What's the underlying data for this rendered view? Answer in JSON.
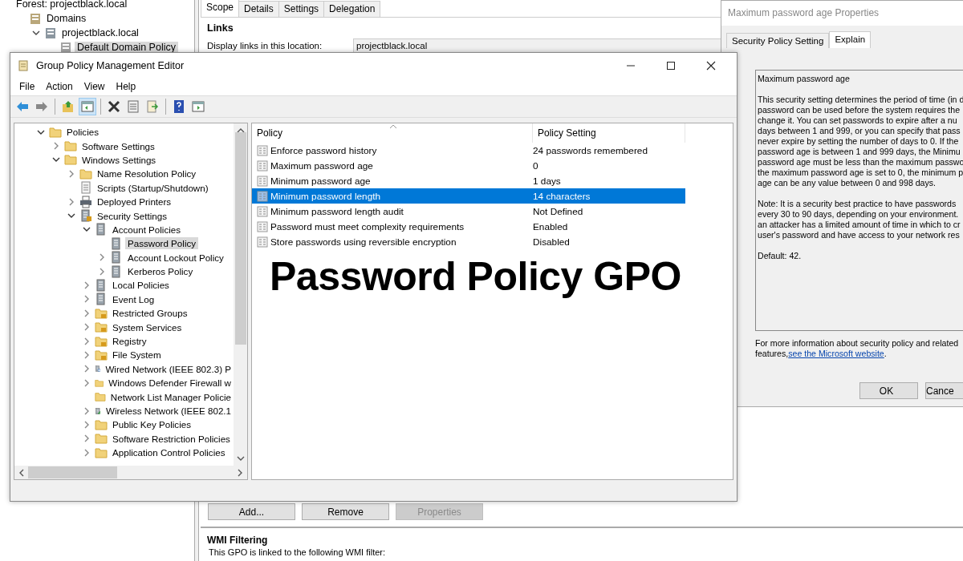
{
  "background_window": {
    "tree": [
      {
        "label": "Forest: projectblack.local",
        "selected": false,
        "children": [
          {
            "label": "Domains",
            "selected": false,
            "children": [
              {
                "label": "projectblack.local",
                "expanded": true,
                "selected": false,
                "children": [
                  {
                    "label": "Default Domain Policy",
                    "selected": true
                  }
                ]
              }
            ]
          }
        ]
      }
    ],
    "tabs": [
      {
        "label": "Scope",
        "selected": true
      },
      {
        "label": "Details",
        "selected": false
      },
      {
        "label": "Settings",
        "selected": false
      },
      {
        "label": "Delegation",
        "selected": false
      }
    ],
    "links_heading": "Links",
    "links_label": "Display links in this location:",
    "links_value": "projectblack.local",
    "buttons": [
      {
        "label": "Add...",
        "disabled": false
      },
      {
        "label": "Remove",
        "disabled": false
      },
      {
        "label": "Properties",
        "disabled": true
      }
    ],
    "wmi_heading": "WMI Filtering",
    "wmi_text": "This GPO is linked to the following WMI filter:"
  },
  "editor": {
    "title": "Group Policy Management Editor",
    "menu": [
      "File",
      "Action",
      "View",
      "Help"
    ],
    "toolbar": [
      {
        "pressed": false
      },
      {
        "pressed": false
      },
      {
        "pressed": false
      },
      {
        "pressed": true
      },
      {
        "pressed": false
      },
      {
        "pressed": false
      },
      {
        "pressed": false
      },
      {
        "pressed": false
      },
      {
        "pressed": false
      }
    ],
    "tree": [
      {
        "label": "Policies",
        "expanded": true,
        "selected": false,
        "children": [
          {
            "label": "Software Settings",
            "expanded": false,
            "selected": false
          },
          {
            "label": "Windows Settings",
            "expanded": true,
            "selected": false,
            "children": [
              {
                "label": "Name Resolution Policy",
                "expanded": false,
                "selected": false
              },
              {
                "label": "Scripts (Startup/Shutdown)",
                "selected": false
              },
              {
                "label": "Deployed Printers",
                "expanded": false,
                "selected": false
              },
              {
                "label": "Security Settings",
                "expanded": true,
                "selected": false,
                "children": [
                  {
                    "label": "Account Policies",
                    "expanded": true,
                    "selected": false,
                    "children": [
                      {
                        "label": "Password Policy",
                        "selected": true
                      },
                      {
                        "label": "Account Lockout Policy",
                        "expanded": false,
                        "selected": false
                      },
                      {
                        "label": "Kerberos Policy",
                        "expanded": false,
                        "selected": false
                      }
                    ]
                  },
                  {
                    "label": "Local Policies",
                    "expanded": false,
                    "selected": false
                  },
                  {
                    "label": "Event Log",
                    "expanded": false,
                    "selected": false
                  },
                  {
                    "label": "Restricted Groups",
                    "expanded": false,
                    "selected": false
                  },
                  {
                    "label": "System Services",
                    "expanded": false,
                    "selected": false
                  },
                  {
                    "label": "Registry",
                    "expanded": false,
                    "selected": false
                  },
                  {
                    "label": "File System",
                    "expanded": false,
                    "selected": false
                  },
                  {
                    "label": "Wired Network (IEEE 802.3) P",
                    "expanded": false,
                    "selected": false
                  },
                  {
                    "label": "Windows Defender Firewall w",
                    "expanded": false,
                    "selected": false
                  },
                  {
                    "label": "Network List Manager Policie",
                    "selected": false
                  },
                  {
                    "label": "Wireless Network (IEEE 802.1",
                    "expanded": false,
                    "selected": false
                  },
                  {
                    "label": "Public Key Policies",
                    "expanded": false,
                    "selected": false
                  },
                  {
                    "label": "Software Restriction Policies",
                    "expanded": false,
                    "selected": false
                  },
                  {
                    "label": "Application Control Policies",
                    "expanded": false,
                    "selected": false
                  }
                ]
              }
            ]
          }
        ]
      }
    ],
    "columns": [
      "Policy",
      "Policy Setting"
    ],
    "rows": [
      {
        "policy": "Enforce password history",
        "setting": "24 passwords remembered",
        "selected": false
      },
      {
        "policy": "Maximum password age",
        "setting": "0",
        "selected": false
      },
      {
        "policy": "Minimum password age",
        "setting": "1 days",
        "selected": false
      },
      {
        "policy": "Minimum password length",
        "setting": "14 characters",
        "selected": true
      },
      {
        "policy": "Minimum password length audit",
        "setting": "Not Defined",
        "selected": false
      },
      {
        "policy": "Password must meet complexity requirements",
        "setting": "Enabled",
        "selected": false
      },
      {
        "policy": "Store passwords using reversible encryption",
        "setting": "Disabled",
        "selected": false
      }
    ],
    "caption": "Password Policy GPO"
  },
  "dialog": {
    "title": "Maximum password age Properties",
    "tabs": [
      {
        "label": "Security Policy Setting",
        "selected": false
      },
      {
        "label": "Explain",
        "selected": true
      }
    ],
    "explain": {
      "heading": "Maximum password age",
      "paragraphs": [
        [
          "This security setting determines the period of time (in d",
          "password can be used before the system requires the",
          "change it. You can set passwords to expire after a nu",
          "days between 1 and 999, or you can specify that pass",
          "never expire by setting the number of days to 0. If the",
          "password age is between 1 and 999 days, the Minimu",
          "password age must be less than the maximum passwo",
          "the maximum password age is set to 0, the minimum p",
          "age can be any value between 0 and 998 days."
        ],
        [
          "Note: It is a security best practice to have passwords",
          "every 30 to 90 days, depending on your environment.",
          "an attacker has a limited amount of time in which to cr",
          "user's password and have access to your network res"
        ],
        [
          "Default: 42."
        ]
      ]
    },
    "more_info": "For more information about security policy and related",
    "more_info_prefix": "features, ",
    "link": "see the Microsoft website",
    "more_info_suffix": ".",
    "buttons": [
      "OK",
      "Cance"
    ]
  }
}
